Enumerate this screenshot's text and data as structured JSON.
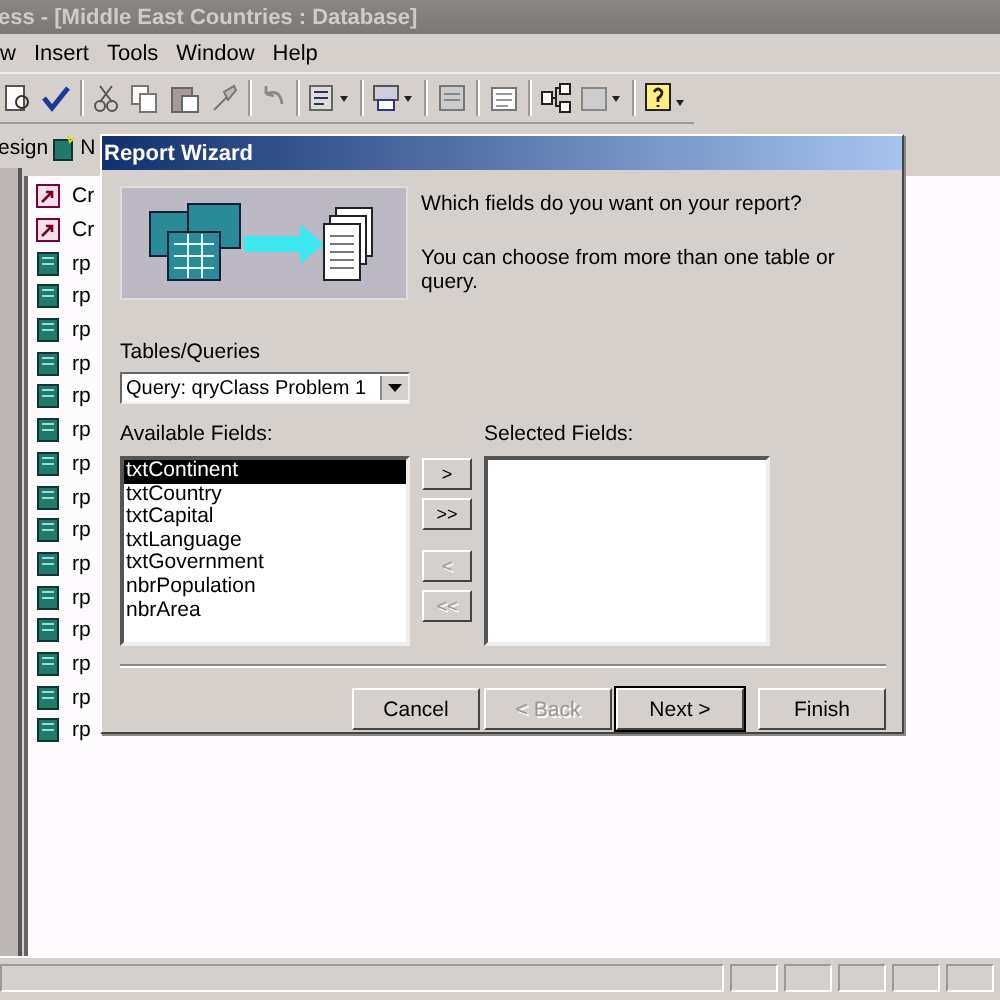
{
  "window": {
    "title": "ess - [Middle East Countries : Database]"
  },
  "menu": [
    "w",
    "Insert",
    "Tools",
    "Window",
    "Help"
  ],
  "db_toolbar": {
    "design_label": "esign",
    "new_label": "N"
  },
  "objects": [
    {
      "kind": "shortcut",
      "label": "Cr"
    },
    {
      "kind": "shortcut",
      "label": "Cr"
    },
    {
      "kind": "report",
      "label": "rp"
    },
    {
      "kind": "report",
      "label": "rp"
    },
    {
      "kind": "report",
      "label": "rp"
    },
    {
      "kind": "report",
      "label": "rp"
    },
    {
      "kind": "report",
      "label": "rp"
    },
    {
      "kind": "report",
      "label": "rp"
    },
    {
      "kind": "report",
      "label": "rp"
    },
    {
      "kind": "report",
      "label": "rp"
    },
    {
      "kind": "report",
      "label": "rp"
    },
    {
      "kind": "report",
      "label": "rp"
    },
    {
      "kind": "report",
      "label": "rp"
    },
    {
      "kind": "report",
      "label": "rp"
    },
    {
      "kind": "report",
      "label": "rp"
    },
    {
      "kind": "report",
      "label": "rp"
    },
    {
      "kind": "report",
      "label": "rp"
    }
  ],
  "dialog": {
    "title": "Report Wizard",
    "question": "Which fields do you want on your report?",
    "hint": "You can choose from more than one table or query.",
    "tables_label": "Tables/Queries",
    "tables_value": "Query: qryClass Problem 1",
    "available_label": "Available Fields:",
    "available_fields": [
      {
        "label": "txtContinent",
        "selected": true
      },
      {
        "label": "txtCountry",
        "selected": false
      },
      {
        "label": "txtCapital",
        "selected": false
      },
      {
        "label": "txtLanguage",
        "selected": false
      },
      {
        "label": "txtGovernment",
        "selected": false
      },
      {
        "label": "nbrPopulation",
        "selected": false
      },
      {
        "label": "nbrArea",
        "selected": false
      }
    ],
    "selected_label": "Selected Fields:",
    "move_buttons": [
      {
        "label": ">",
        "disabled": false
      },
      {
        "label": ">>",
        "disabled": false
      },
      {
        "label": "<",
        "disabled": true
      },
      {
        "label": "<<",
        "disabled": true
      }
    ],
    "buttons": [
      {
        "label": "Cancel",
        "disabled": false,
        "default": false
      },
      {
        "label": "< Back",
        "disabled": true,
        "default": false
      },
      {
        "label": "Next >",
        "disabled": false,
        "default": true
      },
      {
        "label": "Finish",
        "disabled": false,
        "default": false
      }
    ]
  }
}
